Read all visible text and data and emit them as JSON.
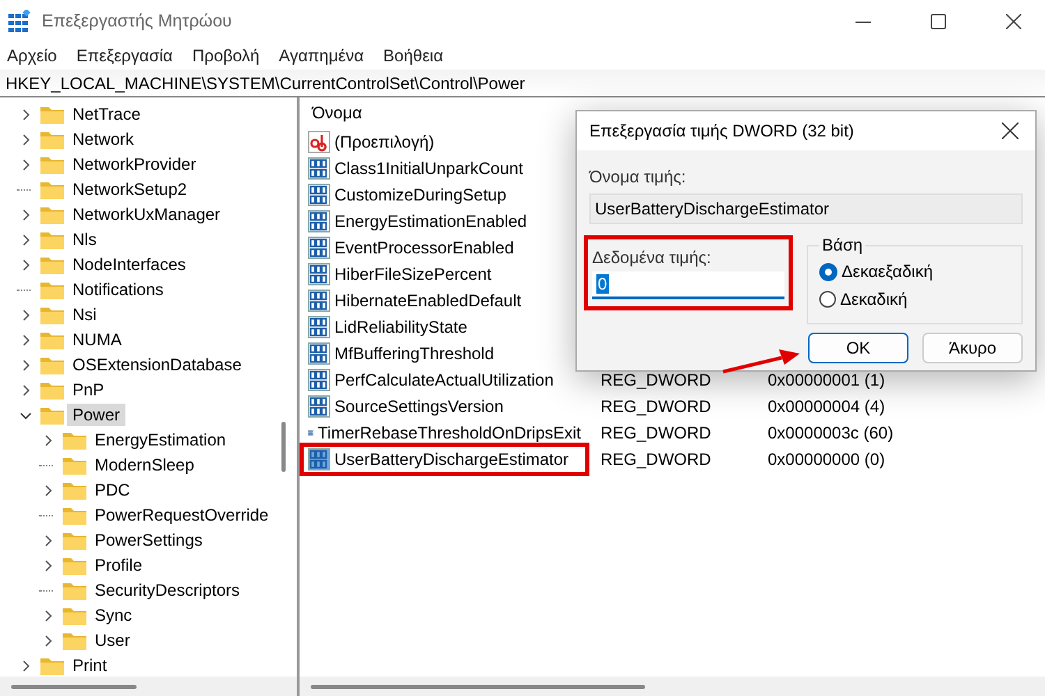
{
  "window": {
    "title": "Επεξεργαστής Μητρώου"
  },
  "menu": [
    "Αρχείο",
    "Επεξεργασία",
    "Προβολή",
    "Αγαπημένα",
    "Βοήθεια"
  ],
  "address": "HKEY_LOCAL_MACHINE\\SYSTEM\\CurrentControlSet\\Control\\Power",
  "tree": [
    {
      "label": "NetTrace",
      "expandable": true,
      "expanded": false,
      "selected": false
    },
    {
      "label": "Network",
      "expandable": true,
      "expanded": false,
      "selected": false
    },
    {
      "label": "NetworkProvider",
      "expandable": true,
      "expanded": false,
      "selected": false
    },
    {
      "label": "NetworkSetup2",
      "expandable": false,
      "selected": false
    },
    {
      "label": "NetworkUxManager",
      "expandable": true,
      "expanded": false,
      "selected": false
    },
    {
      "label": "Nls",
      "expandable": true,
      "expanded": false,
      "selected": false
    },
    {
      "label": "NodeInterfaces",
      "expandable": true,
      "expanded": false,
      "selected": false
    },
    {
      "label": "Notifications",
      "expandable": false,
      "selected": false
    },
    {
      "label": "Nsi",
      "expandable": true,
      "expanded": false,
      "selected": false
    },
    {
      "label": "NUMA",
      "expandable": true,
      "expanded": false,
      "selected": false
    },
    {
      "label": "OSExtensionDatabase",
      "expandable": true,
      "expanded": false,
      "selected": false
    },
    {
      "label": "PnP",
      "expandable": true,
      "expanded": false,
      "selected": false
    },
    {
      "label": "Power",
      "expandable": true,
      "expanded": true,
      "selected": true,
      "children": [
        {
          "label": "EnergyEstimation",
          "expandable": true,
          "expanded": false,
          "selected": false
        },
        {
          "label": "ModernSleep",
          "expandable": false,
          "selected": false
        },
        {
          "label": "PDC",
          "expandable": true,
          "expanded": false,
          "selected": false
        },
        {
          "label": "PowerRequestOverride",
          "expandable": false,
          "selected": false
        },
        {
          "label": "PowerSettings",
          "expandable": true,
          "expanded": false,
          "selected": false
        },
        {
          "label": "Profile",
          "expandable": true,
          "expanded": false,
          "selected": false
        },
        {
          "label": "SecurityDescriptors",
          "expandable": false,
          "selected": false
        },
        {
          "label": "Sync",
          "expandable": true,
          "expanded": false,
          "selected": false
        },
        {
          "label": "User",
          "expandable": true,
          "expanded": false,
          "selected": false
        }
      ]
    },
    {
      "label": "Print",
      "expandable": true,
      "expanded": false,
      "selected": false
    }
  ],
  "values": {
    "columns": [
      "Όνομα"
    ],
    "rows": [
      {
        "kind": "string",
        "name": "(Προεπιλογή)",
        "selected": false,
        "highlighted": false
      },
      {
        "kind": "dword",
        "name": "Class1InitialUnparkCount",
        "selected": false,
        "highlighted": false
      },
      {
        "kind": "dword",
        "name": "CustomizeDuringSetup",
        "selected": false,
        "highlighted": false
      },
      {
        "kind": "dword",
        "name": "EnergyEstimationEnabled",
        "selected": false,
        "highlighted": false
      },
      {
        "kind": "dword",
        "name": "EventProcessorEnabled",
        "selected": false,
        "highlighted": false
      },
      {
        "kind": "dword",
        "name": "HiberFileSizePercent",
        "selected": false,
        "highlighted": false
      },
      {
        "kind": "dword",
        "name": "HibernateEnabledDefault",
        "selected": false,
        "highlighted": false
      },
      {
        "kind": "dword",
        "name": "LidReliabilityState",
        "selected": false,
        "highlighted": false
      },
      {
        "kind": "dword",
        "name": "MfBufferingThreshold",
        "selected": false,
        "highlighted": false
      },
      {
        "kind": "dword",
        "name": "PerfCalculateActualUtilization",
        "type": "REG_DWORD",
        "data": "0x00000001 (1)",
        "selected": false,
        "highlighted": false
      },
      {
        "kind": "dword",
        "name": "SourceSettingsVersion",
        "type": "REG_DWORD",
        "data": "0x00000004 (4)",
        "selected": false,
        "highlighted": false
      },
      {
        "kind": "dword",
        "name": "TimerRebaseThresholdOnDripsExit",
        "type": "REG_DWORD",
        "data": "0x0000003c (60)",
        "selected": false,
        "highlighted": false
      },
      {
        "kind": "dword",
        "name": "UserBatteryDischargeEstimator",
        "type": "REG_DWORD",
        "data": "0x00000000 (0)",
        "selected": true,
        "highlighted": true
      }
    ]
  },
  "dialog": {
    "title": "Επεξεργασία τιμής DWORD (32 bit)",
    "name_label": "Όνομα τιμής:",
    "name_value": "UserBatteryDischargeEstimator",
    "data_label": "Δεδομένα τιμής:",
    "data_value": "0",
    "data_highlighted": true,
    "base_label": "Βάση",
    "base_options": [
      {
        "label": "Δεκαεξαδική",
        "selected": true
      },
      {
        "label": "Δεκαδική",
        "selected": false
      }
    ],
    "buttons": [
      {
        "label": "OK",
        "default": true
      },
      {
        "label": "Άκυρο",
        "default": false
      }
    ]
  }
}
